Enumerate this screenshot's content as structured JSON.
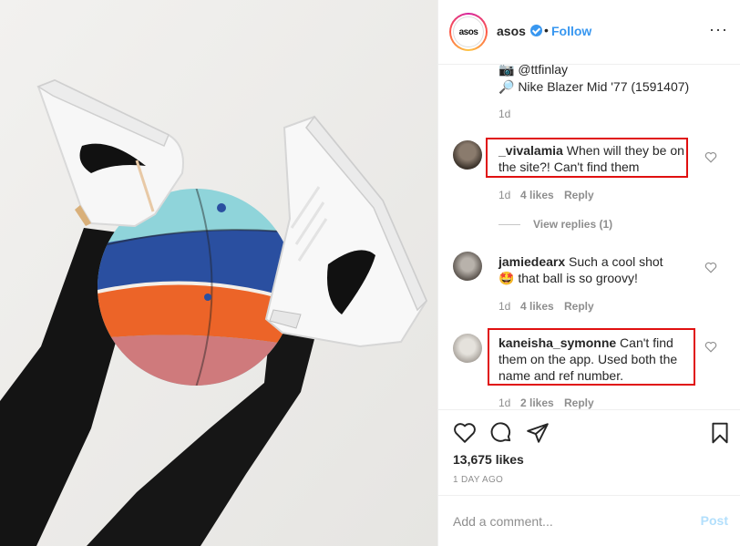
{
  "header": {
    "avatar_text": "asos",
    "username": "asos",
    "separator": "•",
    "follow_label": "Follow",
    "more_label": "···"
  },
  "caption": {
    "line1": "📷 @ttfinlay",
    "line2": "🔎 Nike Blazer Mid '77 (1591407)",
    "time": "1d"
  },
  "comments": [
    {
      "username": "_vivalamia",
      "text": " When will they be on the site?! Can't find them",
      "time": "1d",
      "likes": "4 likes",
      "reply_label": "Reply"
    },
    {
      "username": "jamiedearx",
      "text": " Such a cool shot 🤩 that ball is so groovy!",
      "time": "1d",
      "likes": "4 likes",
      "reply_label": "Reply"
    },
    {
      "username": "kaneisha_symonne",
      "text": " Can't find them on the app. Used both the name and ref number.",
      "time": "1d",
      "likes": "2 likes",
      "reply_label": "Reply"
    }
  ],
  "view_replies_label": "View replies (1)",
  "footer": {
    "likes": "13,675 likes",
    "date": "1 DAY AGO",
    "comment_placeholder": "Add a comment...",
    "post_label": "Post"
  },
  "colors": {
    "link_blue": "#3897f0",
    "highlight_red": "#e01010",
    "post_disabled": "#b2dffc",
    "ball_teal": "#8fd4da",
    "ball_blue": "#2a4fa0",
    "ball_orange": "#ec6428",
    "ball_pink": "#cf7a7c"
  }
}
